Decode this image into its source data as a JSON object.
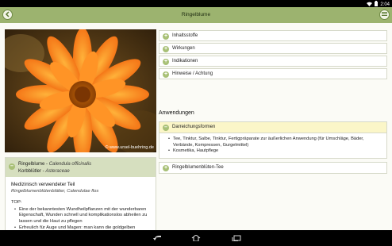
{
  "status_bar": {
    "time": "2:04"
  },
  "action_bar": {
    "title": "Ringelblume"
  },
  "photo": {
    "caption": "© www.ursel-buehring.de"
  },
  "plant": {
    "name": "Ringelblume",
    "name_separator": " - ",
    "latin_name": "Calendula officinalis",
    "family": "Korbblütler",
    "latin_family": "Asteraceae"
  },
  "medicinal": {
    "title": "Medizinisch verwendeter Teil",
    "part": "Ringelblumenblütenblätter, Calendulae flos",
    "top_label": "TOP:",
    "top_items": [
      "Eine der bekanntesten Wundheilpflanzen mit der wunderbaren Eigenschaft, Wunden schnell und komplikationslos abheilen zu lassen und die Haut zu pflegen",
      "Erfreulich für Auge und Magen: man kann die goldgelben Blütenblätter essen!"
    ]
  },
  "sections": [
    {
      "label": "Inhaltsstoffe"
    },
    {
      "label": "Wirkungen"
    },
    {
      "label": "Indikationen"
    },
    {
      "label": "Hinweise / Achtung"
    }
  ],
  "anwendungen": {
    "title": "Anwendungen",
    "darreichung": {
      "label": "Darreichungsformen",
      "items": [
        "Tee, Tinktur, Salbe, Tinktur, Fertigpräparate zur äußerlichen Anwendung (für Umschläge, Bäder, Verbände, Kompressen, Gurgelmittel)",
        "Kosmetika, Hautpflege"
      ]
    },
    "tea": {
      "label": "Ringelblumenblüten-Tee"
    }
  },
  "colors": {
    "action_bar": "#9cb36f",
    "header_highlight": "#d6dfbf",
    "expanded_row": "#fbf6c8",
    "icon_green": "#a8c076"
  }
}
